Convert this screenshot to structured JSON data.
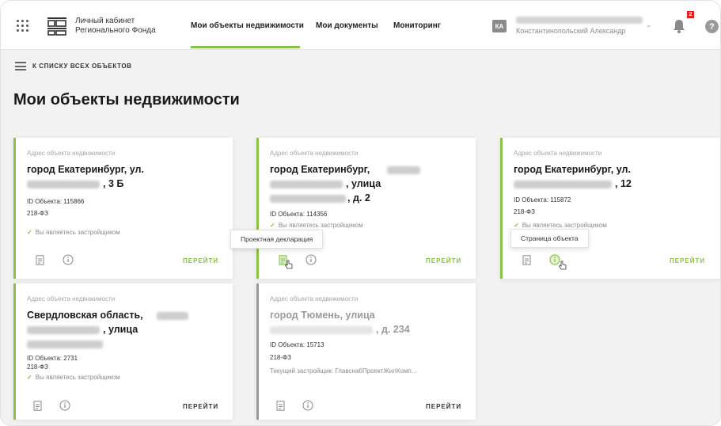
{
  "header": {
    "brand_line1": "Личный кабинет",
    "brand_line2": "Регионального Фонда",
    "nav": [
      "Мои объекты недвижимости",
      "Мои документы",
      "Мониторинг"
    ],
    "user_initials": "КА",
    "user_name": "Константинопольский Александр",
    "notifications_count": "2",
    "help_label": "?"
  },
  "page": {
    "back_label": "К СПИСКУ ВСЕХ ОБЪЕКТОВ",
    "title": "Мои объекты недвижимости"
  },
  "cards": [
    {
      "label": "Адрес объекта недвижимости",
      "title_l1": "город Екатеринбург, ул.",
      "title_l2_end": ", 3 Б",
      "id": "ID Объекта: 115866",
      "law": "218-ФЗ",
      "status": "Вы являетесь застройщиком",
      "go": "ПЕРЕЙТИ"
    },
    {
      "label": "Адрес объекта недвижимости",
      "title_l1": "город Екатеринбург,",
      "title_l2_end": ", улица",
      "title_l3_end": ", д. 2",
      "id": "ID Объекта: 114356",
      "status": "Вы являетесь застройщиком",
      "tooltip": "Проектная декларация",
      "go": "ПЕРЕЙТИ"
    },
    {
      "label": "Адрес объекта недвижимости",
      "title_l1": "город Екатеринбург, ул.",
      "title_l2_end": ", 12",
      "id": "ID Объекта: 115872",
      "law": "218-ФЗ",
      "status": "Вы являетесь застройщиком",
      "tooltip": "Страница объекта",
      "go": "ПЕРЕЙТИ"
    },
    {
      "label": "Адрес объекта недвижимости",
      "title_l1": "Свердловская область,",
      "title_l2_end": ", улица",
      "id": "ID Объекта: 2731",
      "law": "218-ФЗ",
      "status": "Вы являетесь застройщиком",
      "go": "ПЕРЕЙТИ"
    },
    {
      "label": "Адрес объекта недвижимости",
      "title_l1": "город Тюмень, улица",
      "title_l2_end": ", д. 234",
      "id": "ID Объекта: 15713",
      "law": "218-ФЗ",
      "developer": "Текущий застройщик: ГлавснабПроектЖилКомп...",
      "go": "ПЕРЕЙТИ"
    }
  ],
  "colors": {
    "accent": "#8ac148",
    "inactive": "#9a9a9a",
    "badge": "#e32020"
  },
  "icons": [
    "apps-grid-icon",
    "logo-icon",
    "chevron-down-icon",
    "bell-icon",
    "help-icon",
    "list-icon",
    "document-icon",
    "info-icon",
    "hand-cursor-icon",
    "check-icon"
  ]
}
